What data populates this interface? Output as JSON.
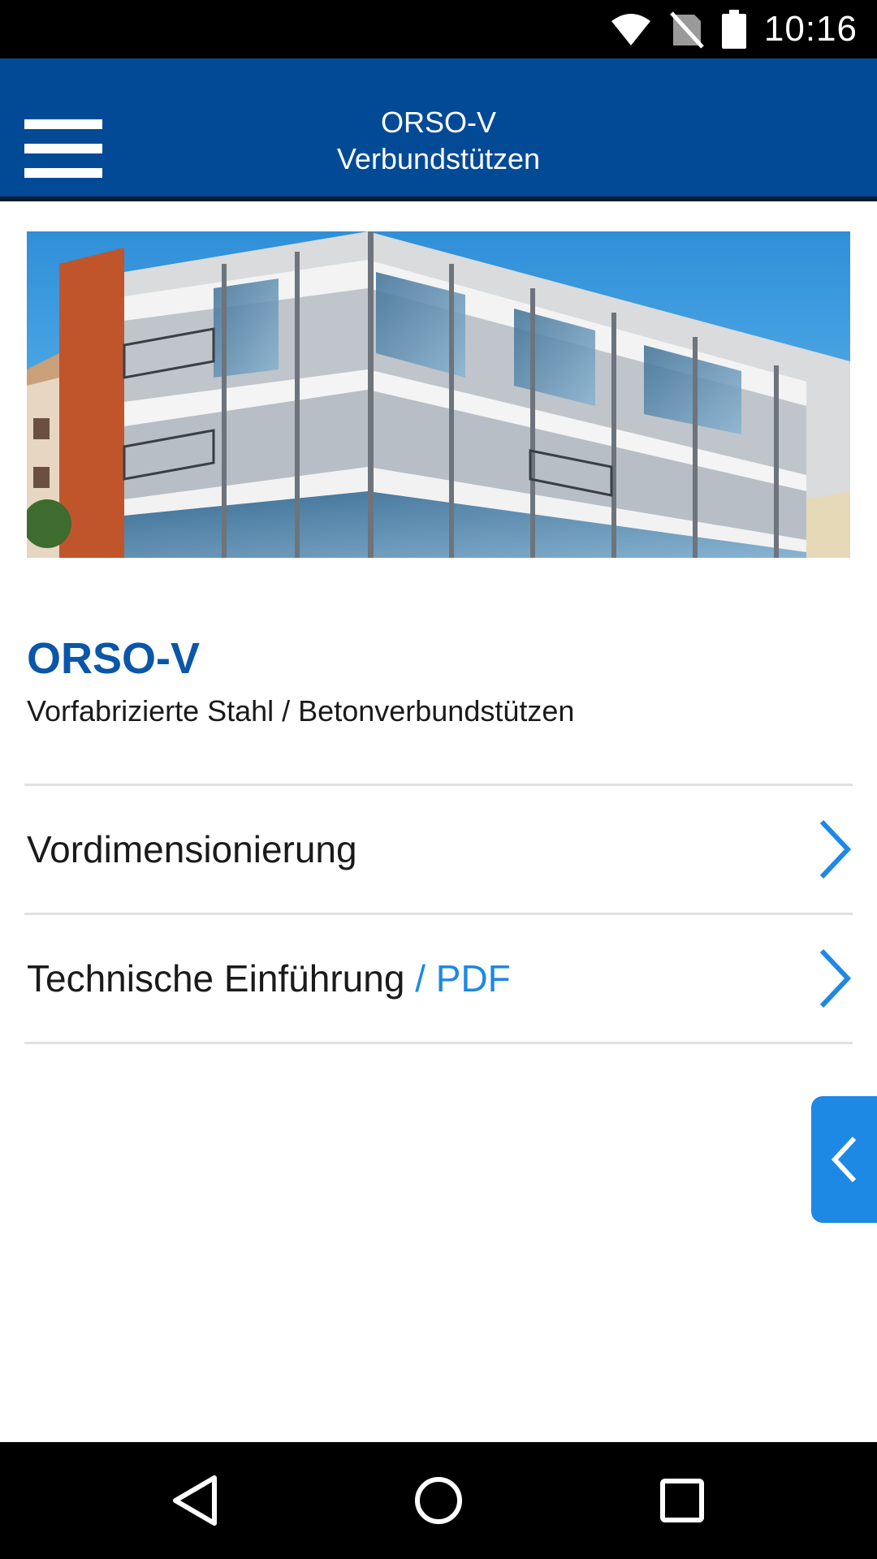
{
  "status_bar": {
    "time": "10:16",
    "icons": [
      "wifi-icon",
      "no-sim-icon",
      "battery-icon"
    ]
  },
  "header": {
    "title_line1": "ORSO-V",
    "title_line2": "Verbundstützen",
    "menu_icon": "hamburger-menu-icon",
    "background_color": "#034a96"
  },
  "hero": {
    "description_icon": "building-photo"
  },
  "product": {
    "title": "ORSO-V",
    "subtitle": "Vorfabrizierte Stahl / Betonverbundstützen",
    "title_color": "#0a56a8"
  },
  "list": {
    "items": [
      {
        "label": "Vordimensionierung",
        "suffix": ""
      },
      {
        "label": "Technische Einführung",
        "suffix": " / PDF"
      }
    ],
    "chevron_color": "#1e88e5"
  },
  "side_tab": {
    "icon": "chevron-left-icon",
    "color": "#1e88e5"
  },
  "nav_bar": {
    "buttons": [
      "back-icon",
      "home-icon",
      "recents-icon"
    ]
  }
}
